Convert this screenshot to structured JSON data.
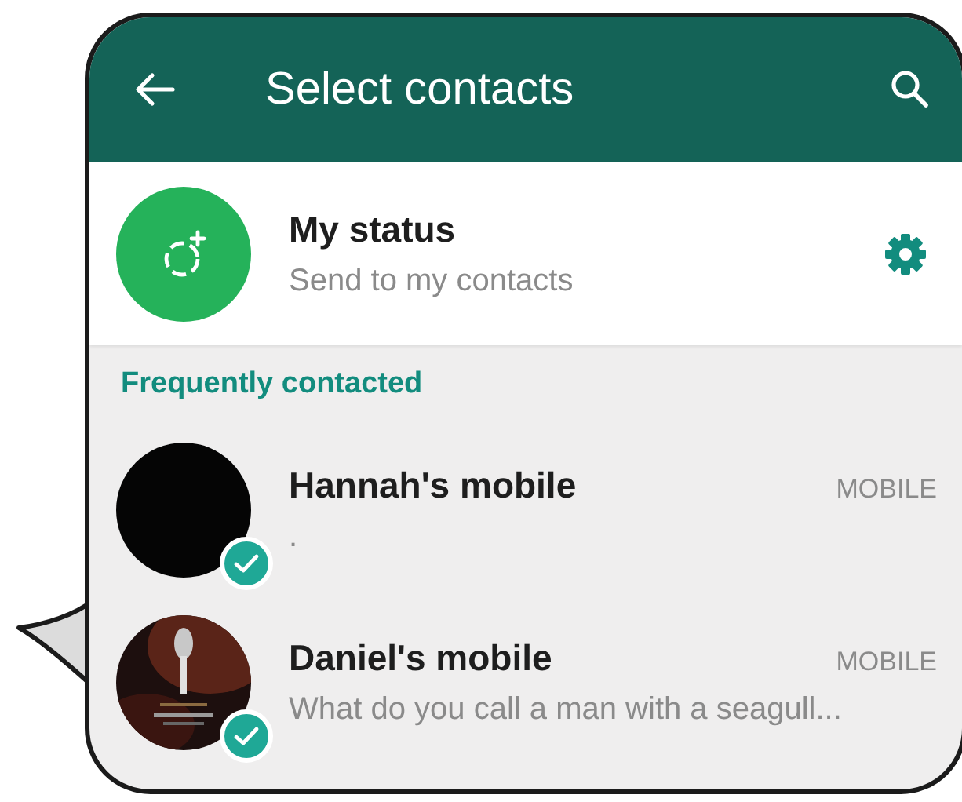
{
  "header": {
    "title": "Select contacts"
  },
  "my_status": {
    "name": "My status",
    "subtitle": "Send to my contacts"
  },
  "section": {
    "title": "Frequently contacted"
  },
  "contacts": [
    {
      "name": "Hannah's mobile",
      "status": ".",
      "type": "MOBILE",
      "selected": true,
      "kind": "blank"
    },
    {
      "name": "Daniel's mobile",
      "status": "What do you call a man with a seagull...",
      "type": "MOBILE",
      "selected": true,
      "kind": "picture"
    }
  ]
}
